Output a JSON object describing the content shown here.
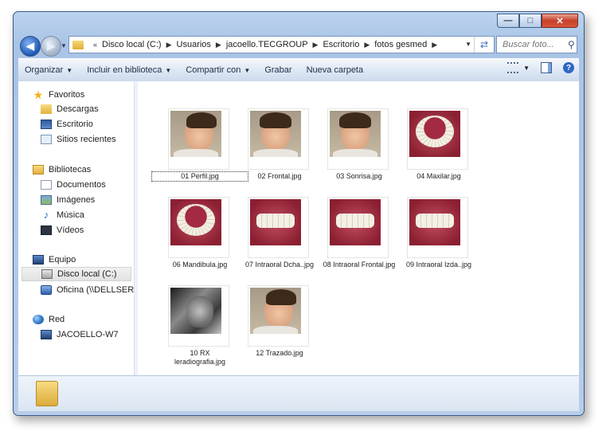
{
  "window": {
    "caption_buttons": {
      "minimize": "—",
      "maximize": "□",
      "close": "✕"
    }
  },
  "navigation": {
    "address_breadcrumbs": [
      "Disco local (C:)",
      "Usuarios",
      "jacoello.TECGROUP",
      "Escritorio",
      "fotos gesmed"
    ],
    "leading_chevron": "«",
    "search_placeholder": "Buscar foto..."
  },
  "toolbar": {
    "organize": "Organizar",
    "include_library": "Incluir en biblioteca",
    "share": "Compartir con",
    "burn": "Grabar",
    "new_folder": "Nueva carpeta"
  },
  "sidebar": {
    "favorites": {
      "title": "Favoritos",
      "items": [
        "Descargas",
        "Escritorio",
        "Sitios recientes"
      ]
    },
    "libraries": {
      "title": "Bibliotecas",
      "items": [
        "Documentos",
        "Imágenes",
        "Música",
        "Vídeos"
      ]
    },
    "computer": {
      "title": "Equipo",
      "items": [
        "Disco local (C:)",
        "Oficina (\\\\DELLSERV"
      ]
    },
    "network": {
      "title": "Red",
      "items": [
        "JACOELLO-W7"
      ]
    }
  },
  "files": [
    {
      "name": "01 Perfil.jpg",
      "kind": "face-side"
    },
    {
      "name": "02 Frontal.jpg",
      "kind": "face"
    },
    {
      "name": "03 Sonrisa.jpg",
      "kind": "face"
    },
    {
      "name": "04 Maxilar.jpg",
      "kind": "arch"
    },
    {
      "name": "06 Mandibula.jpg",
      "kind": "arch"
    },
    {
      "name": "07 Intraoral Dcha..jpg",
      "kind": "mouth"
    },
    {
      "name": "08 Intraoral Frontal.jpg",
      "kind": "mouth"
    },
    {
      "name": "09 Intraoral Izda..jpg",
      "kind": "mouth"
    },
    {
      "name": "10 RX\nleradiografia.jpg",
      "kind": "xray"
    },
    {
      "name": "12 Trazado.jpg",
      "kind": "face-side"
    }
  ],
  "colors": {
    "accent": "#2f66c4",
    "title_gradient": "#bcd3ee",
    "close_button": "#c7402b"
  }
}
